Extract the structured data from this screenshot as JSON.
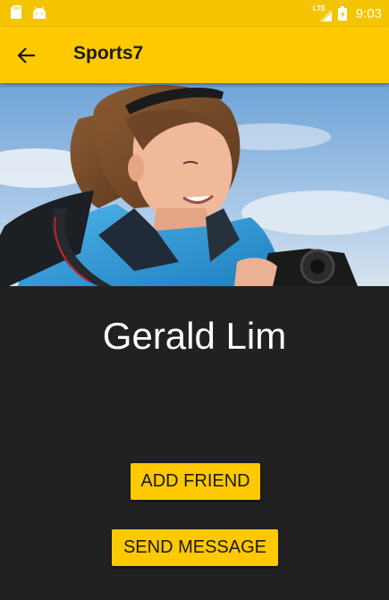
{
  "status_bar": {
    "time": "9:03",
    "network_label": "LTE",
    "icons": [
      "sd-card-icon",
      "android-icon",
      "lte-signal-icon",
      "battery-charging-icon"
    ]
  },
  "app_bar": {
    "title": "Sports7",
    "back_icon": "arrow-left-icon"
  },
  "colors": {
    "accent": "#ffc900",
    "status_bar": "#f5c400",
    "background": "#212121",
    "text_primary": "#ffffff",
    "button_text": "#1a1a1a"
  },
  "profile": {
    "name": "Gerald Lim",
    "photo_icon": "profile-photo"
  },
  "actions": {
    "add_friend_label": "ADD FRIEND",
    "send_message_label": "SEND MESSAGE"
  }
}
